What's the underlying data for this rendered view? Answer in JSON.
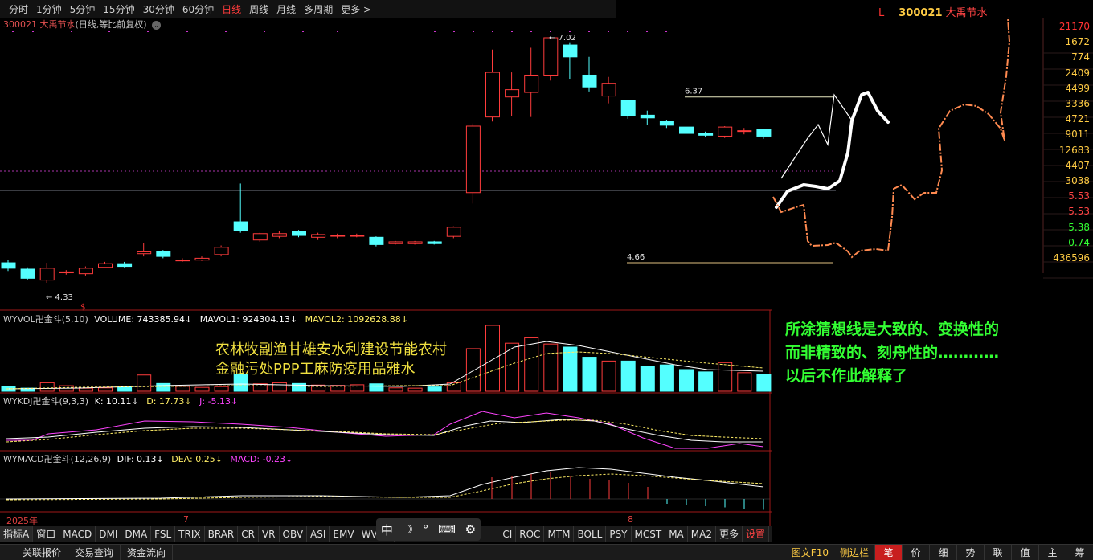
{
  "period_bar": [
    "分时",
    "1分钟",
    "5分钟",
    "15分钟",
    "30分钟",
    "60分钟",
    "日线",
    "周线",
    "月线",
    "多周期",
    "更多 >"
  ],
  "period_active": "日线",
  "stock": {
    "code_name": "300021 大禹节水",
    "sub": "(日线,等比前复权)"
  },
  "chart_data": {
    "type": "candlestick",
    "candles": [
      {
        "o": 4.55,
        "c": 4.49,
        "h": 4.58,
        "l": 4.46
      },
      {
        "o": 4.48,
        "c": 4.38,
        "h": 4.5,
        "l": 4.36
      },
      {
        "o": 4.36,
        "c": 4.49,
        "h": 4.55,
        "l": 4.33
      },
      {
        "o": 4.44,
        "c": 4.45,
        "h": 4.47,
        "l": 4.42
      },
      {
        "o": 4.43,
        "c": 4.49,
        "h": 4.51,
        "l": 4.41
      },
      {
        "o": 4.5,
        "c": 4.54,
        "h": 4.56,
        "l": 4.49
      },
      {
        "o": 4.54,
        "c": 4.51,
        "h": 4.56,
        "l": 4.5
      },
      {
        "o": 4.65,
        "c": 4.67,
        "h": 4.77,
        "l": 4.62
      },
      {
        "o": 4.67,
        "c": 4.62,
        "h": 4.69,
        "l": 4.6
      },
      {
        "o": 4.58,
        "c": 4.58,
        "h": 4.6,
        "l": 4.56
      },
      {
        "o": 4.58,
        "c": 4.6,
        "h": 4.62,
        "l": 4.57
      },
      {
        "o": 4.64,
        "c": 4.72,
        "h": 4.74,
        "l": 4.62
      },
      {
        "o": 5.0,
        "c": 4.9,
        "h": 5.42,
        "l": 4.88
      },
      {
        "o": 4.8,
        "c": 4.87,
        "h": 4.88,
        "l": 4.78
      },
      {
        "o": 4.84,
        "c": 4.87,
        "h": 4.9,
        "l": 4.82
      },
      {
        "o": 4.89,
        "c": 4.85,
        "h": 4.91,
        "l": 4.83
      },
      {
        "o": 4.83,
        "c": 4.86,
        "h": 4.88,
        "l": 4.8
      },
      {
        "o": 4.85,
        "c": 4.85,
        "h": 4.87,
        "l": 4.82
      },
      {
        "o": 4.85,
        "c": 4.85,
        "h": 4.87,
        "l": 4.83
      },
      {
        "o": 4.83,
        "c": 4.75,
        "h": 4.84,
        "l": 4.73
      },
      {
        "o": 4.76,
        "c": 4.78,
        "h": 4.79,
        "l": 4.75
      },
      {
        "o": 4.76,
        "c": 4.78,
        "h": 4.79,
        "l": 4.75
      },
      {
        "o": 4.78,
        "c": 4.76,
        "h": 4.79,
        "l": 4.75
      },
      {
        "o": 4.84,
        "c": 4.94,
        "h": 4.95,
        "l": 4.82
      },
      {
        "o": 5.32,
        "c": 6.05,
        "h": 6.08,
        "l": 5.2
      },
      {
        "o": 6.15,
        "c": 6.64,
        "h": 6.89,
        "l": 6.1
      },
      {
        "o": 6.37,
        "c": 6.45,
        "h": 6.64,
        "l": 6.16
      },
      {
        "o": 6.42,
        "c": 6.61,
        "h": 6.91,
        "l": 6.15
      },
      {
        "o": 6.61,
        "c": 7.02,
        "h": 7.03,
        "l": 6.55
      },
      {
        "o": 6.94,
        "c": 6.81,
        "h": 6.97,
        "l": 6.57
      },
      {
        "o": 6.61,
        "c": 6.48,
        "h": 6.81,
        "l": 6.43
      },
      {
        "o": 6.38,
        "c": 6.52,
        "h": 6.59,
        "l": 6.3
      },
      {
        "o": 6.33,
        "c": 6.16,
        "h": 6.34,
        "l": 6.13
      },
      {
        "o": 6.17,
        "c": 6.14,
        "h": 6.22,
        "l": 6.06
      },
      {
        "o": 6.1,
        "c": 6.06,
        "h": 6.12,
        "l": 6.03
      },
      {
        "o": 6.04,
        "c": 5.97,
        "h": 6.05,
        "l": 5.95
      },
      {
        "o": 5.97,
        "c": 5.95,
        "h": 5.99,
        "l": 5.93
      },
      {
        "o": 5.94,
        "c": 6.04,
        "h": 6.05,
        "l": 5.92
      },
      {
        "o": 6.0,
        "c": 6.0,
        "h": 6.03,
        "l": 5.96
      },
      {
        "o": 6.01,
        "c": 5.94,
        "h": 6.02,
        "l": 5.91
      }
    ],
    "high_label": "7.02",
    "low_label": "4.33",
    "ref_high": "6.37",
    "ref_low": "4.66",
    "volume_values": [
      0.3,
      0.2,
      0.55,
      0.36,
      0.2,
      0.22,
      0.26,
      1.05,
      0.5,
      0.32,
      0.25,
      0.3,
      1.1,
      0.48,
      0.55,
      0.5,
      0.4,
      0.38,
      0.42,
      0.48,
      0.22,
      0.2,
      0.28,
      0.55,
      2.75,
      4.25,
      3.1,
      3.45,
      3.05,
      2.85,
      2.2,
      1.95,
      1.95,
      1.6,
      1.7,
      1.4,
      1.25,
      1.85,
      1.2,
      1.1
    ]
  },
  "labels": {
    "vol": {
      "name": "WYVOL卍金斗(5,10)",
      "volume": "VOLUME: 743385.94↓",
      "mavol1": "MAVOL1: 924304.13↓",
      "mavol2": "MAVOL2: 1092628.88↓"
    },
    "kdj": {
      "name": "WYKDJ卍金斗(9,3,3)",
      "k": "K: 10.11↓",
      "d": "D: 17.73↓",
      "j": "J: -5.13↓"
    },
    "macd": {
      "name": "WYMACD卍金斗(12,26,9)",
      "dif": "DIF: 0.13↓",
      "dea": "DEA: 0.25↓",
      "macd": "MACD: -0.23↓"
    }
  },
  "overlay_text": [
    "农林牧副渔甘雄安水利建设节能农村",
    "金融污处PPP工麻防疫用品雅水"
  ],
  "note_text": [
    "所涂猜想线是大致的、变换性的",
    "而非精致的、刻舟性的…………",
    "以后不作此解释了"
  ],
  "right_header": {
    "l": "L",
    "code": "300021",
    "name": "大禹节水"
  },
  "right_values": [
    {
      "v": "21170",
      "c": "#ff3333"
    },
    {
      "v": "1672",
      "c": "#ffcc44"
    },
    {
      "v": "774",
      "c": "#ffcc44"
    },
    {
      "v": "2409",
      "c": "#ffcc44"
    },
    {
      "v": "4499",
      "c": "#ffcc44"
    },
    {
      "v": "3336",
      "c": "#ffcc44"
    },
    {
      "v": "4721",
      "c": "#ffcc44"
    },
    {
      "v": "9011",
      "c": "#ffcc44"
    },
    {
      "v": "12683",
      "c": "#ffcc44"
    },
    {
      "v": "4407",
      "c": "#ffcc44"
    },
    {
      "v": "3038",
      "c": "#ffcc44"
    },
    {
      "v": "5.53",
      "c": "#ff4444"
    },
    {
      "v": "5.53",
      "c": "#ff4444"
    },
    {
      "v": "5.38",
      "c": "#33ff33"
    },
    {
      "v": "0.74",
      "c": "#33ff33"
    },
    {
      "v": "436596",
      "c": "#ffcc44"
    }
  ],
  "date_labels": [
    "2025年",
    "7",
    "8"
  ],
  "indicator_tabs": [
    "指标A",
    "窗口",
    "MACD",
    "DMI",
    "DMA",
    "FSL",
    "TRIX",
    "BRAR",
    "CR",
    "VR",
    "OBV",
    "ASI",
    "EMV",
    "WVAD",
    "CI",
    "ROC",
    "MTM",
    "BOLL",
    "PSY",
    "MCST",
    "MA",
    "MA2",
    "更多",
    "设置"
  ],
  "ime": [
    "中",
    "☽",
    "°",
    "⌨",
    "⚙"
  ],
  "status_left": [
    "关联报价",
    "交易查询",
    "资金流向"
  ],
  "status_right_text": [
    "图文F10",
    "侧边栏"
  ],
  "status_right_btns": [
    "笔",
    "价",
    "细",
    "势",
    "联",
    "值",
    "主",
    "筹"
  ],
  "colors": {
    "up": "#ff3c3c",
    "down": "#54ffff",
    "k": "#ffffff",
    "d": "#ffee66",
    "j": "#ff44ff"
  }
}
